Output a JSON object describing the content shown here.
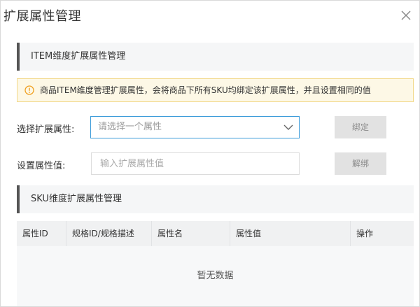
{
  "dialog": {
    "title": "扩展属性管理",
    "close_icon": "close-icon"
  },
  "item_section": {
    "title": "ITEM维度扩展属性管理",
    "notice": {
      "icon": "warning-circle-icon",
      "text": "商品ITEM维度管理扩展属性，会将商品下所有SKU均绑定该扩展属性，并且设置相同的值"
    },
    "select_label": "选择扩展属性:",
    "select_placeholder": "请选择一个属性",
    "bind_button": "绑定",
    "value_label": "设置属性值:",
    "value_placeholder": "输入扩展属性值",
    "unbind_button": "解绑"
  },
  "sku_section": {
    "title": "SKU维度扩展属性管理",
    "table": {
      "columns": [
        "属性ID",
        "规格ID/规格描述",
        "属性名",
        "属性值",
        "操作"
      ],
      "rows": [],
      "empty_text": "暂无数据"
    }
  },
  "colors": {
    "accent_border": "#3b9bd9",
    "notice_bg": "#fdf8e6",
    "notice_border": "#f2d98a",
    "warning_icon": "#f0a020",
    "section_bar": "#555555"
  }
}
